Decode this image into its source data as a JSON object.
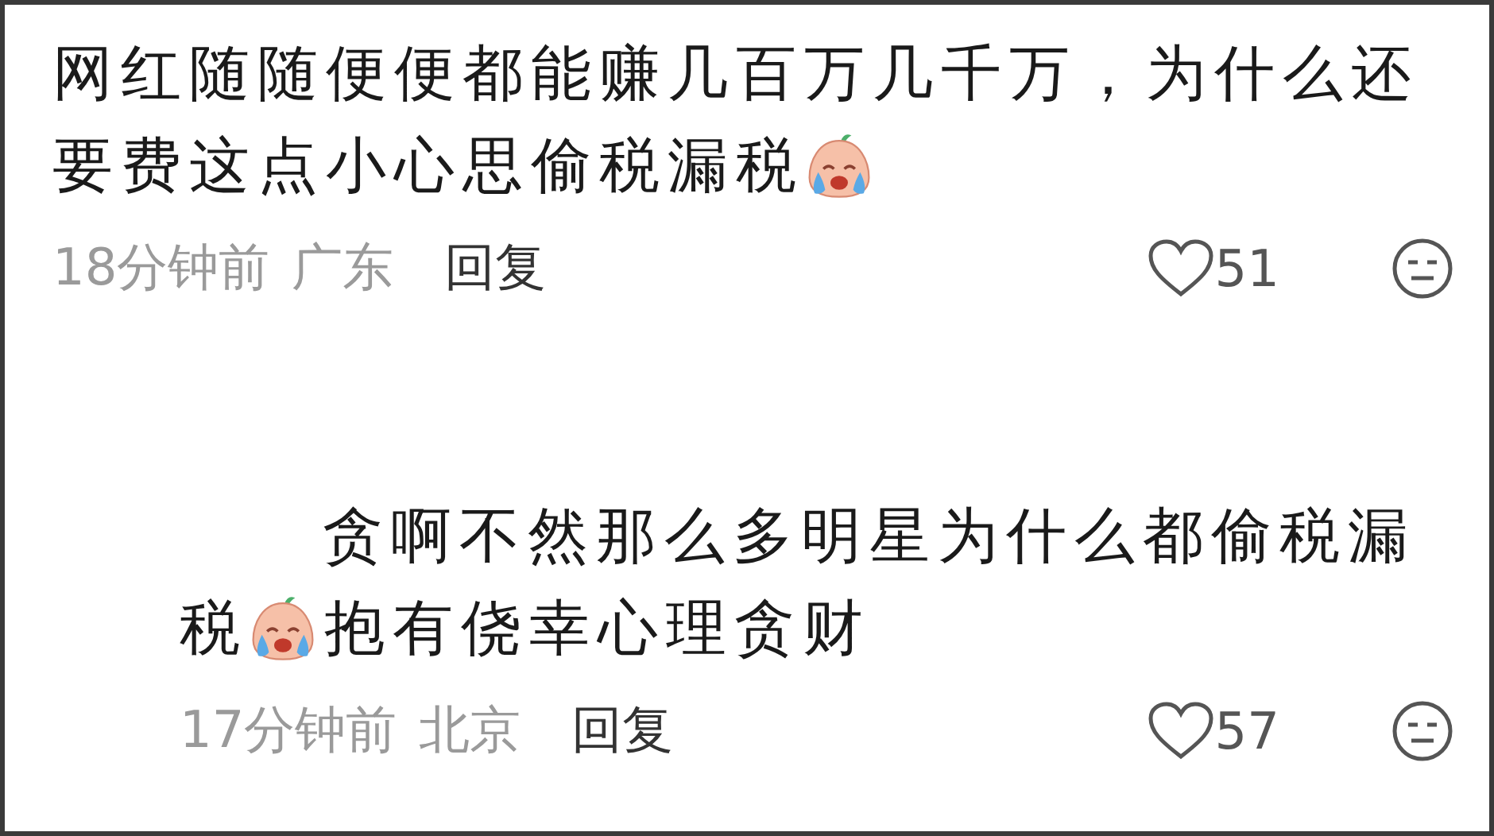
{
  "comments": [
    {
      "reply": false,
      "lines": [
        [
          {
            "kind": "text",
            "text": "网红随随便便都能赚几百万几千万，为什么还"
          }
        ],
        [
          {
            "kind": "text",
            "text": "要费这点小心思偷税漏税"
          },
          {
            "kind": "emoji"
          }
        ]
      ],
      "time": "18分钟前",
      "location": "广东",
      "reply_label": "回复",
      "likes": "51"
    },
    {
      "reply": true,
      "lines": [
        [
          {
            "kind": "text",
            "text": "贪啊不然那么多明星为什么都偷税漏"
          }
        ],
        [
          {
            "kind": "text",
            "text": "税"
          },
          {
            "kind": "emoji"
          },
          {
            "kind": "text",
            "text": "抱有侥幸心理贪财"
          }
        ]
      ],
      "time": "17分钟前",
      "location": "北京",
      "reply_label": "回复",
      "likes": "57"
    }
  ]
}
